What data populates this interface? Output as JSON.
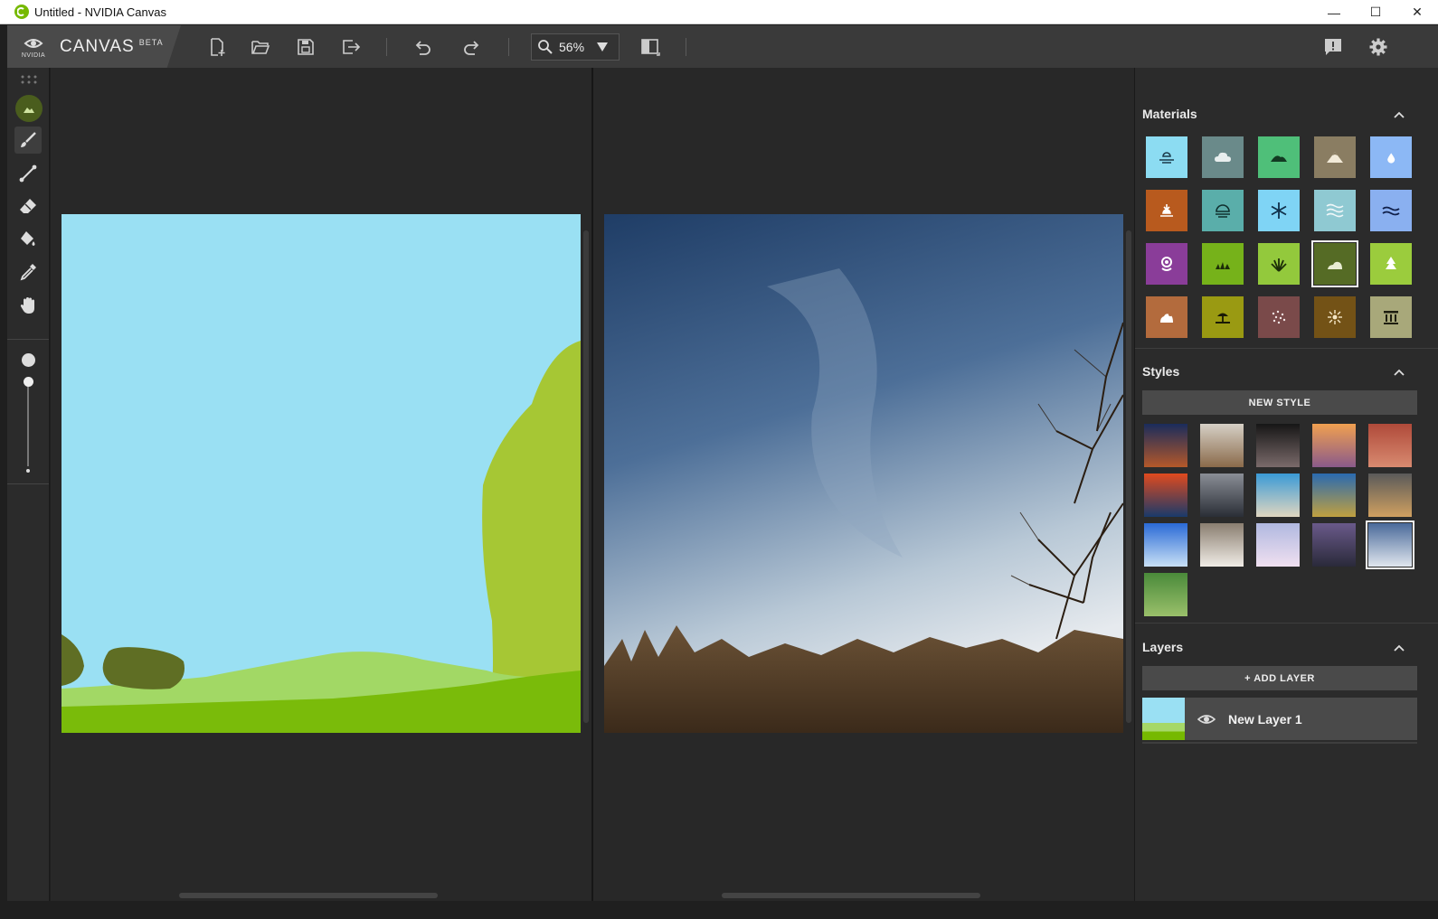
{
  "window": {
    "title": "Untitled - NVIDIA Canvas",
    "minimize": "—",
    "maximize": "☐",
    "close": "✕"
  },
  "toolbar": {
    "brand_logo_text": "NVIDIA",
    "app_name": "CANVAS",
    "badge": "BETA",
    "zoom_value": "56%",
    "icons": [
      "new-file-icon",
      "open-folder-icon",
      "save-icon",
      "export-icon",
      "undo-icon",
      "redo-icon",
      "zoom-icon",
      "compare-view-icon",
      "feedback-icon",
      "gear-icon"
    ]
  },
  "leftbar": {
    "tools": [
      "material-icon",
      "brush-icon",
      "line-icon",
      "eraser-icon",
      "fill-icon",
      "eyedropper-icon",
      "hand-icon"
    ],
    "brush_size_fraction": 0.25
  },
  "materials": {
    "title": "Materials",
    "items": [
      {
        "name": "sky",
        "color": "#8cdcf2",
        "icon": "horizon"
      },
      {
        "name": "cloud",
        "color": "#6a8a8a",
        "icon": "cloud"
      },
      {
        "name": "hill",
        "color": "#4fbf79",
        "icon": "hill"
      },
      {
        "name": "mountain",
        "color": "#8a7d62",
        "icon": "mountain"
      },
      {
        "name": "water",
        "color": "#8cb8f5",
        "icon": "drop"
      },
      {
        "name": "rock",
        "color": "#b85a1e",
        "icon": "sunset"
      },
      {
        "name": "fog",
        "color": "#5aaeaa",
        "icon": "fog"
      },
      {
        "name": "snow",
        "color": "#7fd4f5",
        "icon": "snowflake"
      },
      {
        "name": "river",
        "color": "#8fc9d2",
        "icon": "waves"
      },
      {
        "name": "sea",
        "color": "#8ab0f0",
        "icon": "wave"
      },
      {
        "name": "flower",
        "color": "#8a3d99",
        "icon": "flower"
      },
      {
        "name": "grass",
        "color": "#76b21a",
        "icon": "grass"
      },
      {
        "name": "plant",
        "color": "#93c93c",
        "icon": "plant"
      },
      {
        "name": "bush",
        "color": "#556b25",
        "icon": "bush"
      },
      {
        "name": "tree",
        "color": "#9bcc3d",
        "icon": "tree"
      },
      {
        "name": "dirt",
        "color": "#b36b3d",
        "icon": "rocks"
      },
      {
        "name": "sand",
        "color": "#9a9a12",
        "icon": "beach"
      },
      {
        "name": "gravel",
        "color": "#7a4a4a",
        "icon": "gravel"
      },
      {
        "name": "stone",
        "color": "#735216",
        "icon": "burst"
      },
      {
        "name": "building",
        "color": "#a8a87a",
        "icon": "temple"
      }
    ],
    "selected_index": 13
  },
  "styles": {
    "title": "Styles",
    "new_style_label": "NEW STYLE",
    "count": 16,
    "selected_index": 14
  },
  "layers": {
    "title": "Layers",
    "add_layer_label": "+ ADD LAYER",
    "items": [
      {
        "name": "New Layer 1",
        "visible": true
      }
    ]
  }
}
